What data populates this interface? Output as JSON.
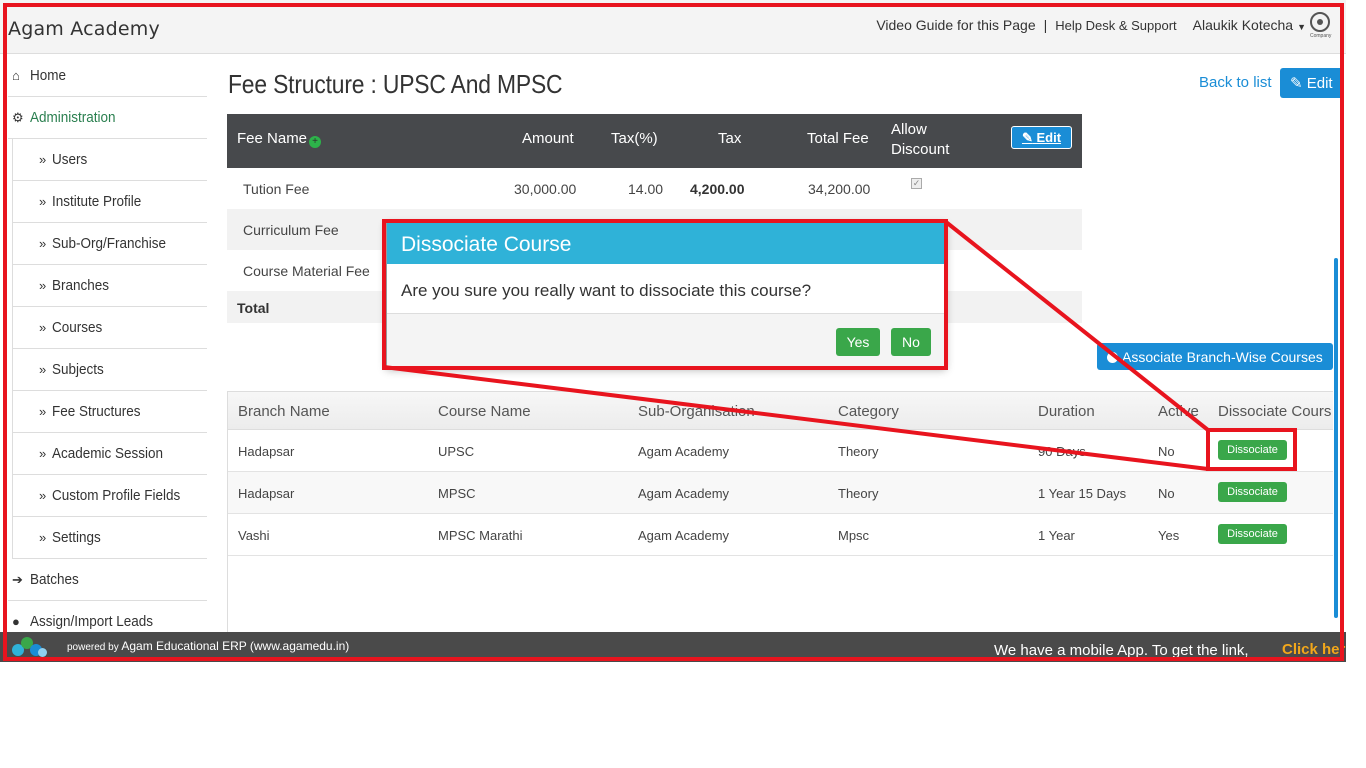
{
  "header": {
    "brand": "Agam Academy",
    "video_guide": "Video Guide for this Page",
    "separator": "|",
    "help": "Help Desk & Support",
    "user": "Alaukik Kotecha",
    "company_caption": "Company"
  },
  "sidebar": {
    "items": [
      {
        "label": "Home",
        "icon": "home-icon"
      },
      {
        "label": "Administration",
        "icon": "gear-icon"
      },
      {
        "label": "Users"
      },
      {
        "label": "Institute Profile"
      },
      {
        "label": "Sub-Org/Franchise"
      },
      {
        "label": "Branches"
      },
      {
        "label": "Courses"
      },
      {
        "label": "Subjects"
      },
      {
        "label": "Fee Structures"
      },
      {
        "label": "Academic Session"
      },
      {
        "label": "Custom Profile Fields"
      },
      {
        "label": "Settings"
      },
      {
        "label": "Batches",
        "icon": "sign-in-icon"
      },
      {
        "label": "Assign/Import Leads",
        "icon": "user-icon"
      }
    ],
    "sub_chevron": "»"
  },
  "main": {
    "title": "Fee Structure : UPSC And MPSC",
    "back_link": "Back to list",
    "edit_label": "Edit"
  },
  "fee_table": {
    "headers": {
      "fee_name": "Fee Name",
      "amount": "Amount",
      "tax_pct": "Tax(%)",
      "tax": "Tax",
      "total_fee": "Total Fee",
      "allow_discount_1": "Allow",
      "allow_discount_2": "Discount",
      "edit": "Edit"
    },
    "rows": [
      {
        "name": "Tution Fee",
        "amount": "30,000.00",
        "tax_pct": "14.00",
        "tax": "4,200.00",
        "total": "34,200.00",
        "allow_discount": true
      },
      {
        "name": "Curriculum Fee"
      },
      {
        "name": "Course Material Fee"
      }
    ],
    "total_label": "Total"
  },
  "associate_button": "Associate Branch-Wise Courses",
  "branch_table": {
    "headers": {
      "branch": "Branch Name",
      "course": "Course Name",
      "suborg": "Sub-Organisation",
      "category": "Category",
      "duration": "Duration",
      "active": "Active",
      "dissociate": "Dissociate Cours"
    },
    "rows": [
      {
        "branch": "Hadapsar",
        "course": "UPSC",
        "suborg": "Agam Academy",
        "category": "Theory",
        "duration": "90 Days",
        "active": "No",
        "action": "Dissociate"
      },
      {
        "branch": "Hadapsar",
        "course": "MPSC",
        "suborg": "Agam Academy",
        "category": "Theory",
        "duration": "1 Year 15 Days",
        "active": "No",
        "action": "Dissociate"
      },
      {
        "branch": "Vashi",
        "course": "MPSC Marathi",
        "suborg": "Agam Academy",
        "category": "Mpsc",
        "duration": "1 Year",
        "active": "Yes",
        "action": "Dissociate"
      }
    ]
  },
  "modal": {
    "title": "Dissociate Course",
    "message": "Are you sure you really want to dissociate this course?",
    "yes": "Yes",
    "no": "No"
  },
  "footer": {
    "powered_prefix": "powered by",
    "powered_text": "Agam Educational ERP (www.agamedu.in)",
    "mobile_text": "We have a mobile App. To get the link,",
    "click_here": "Click her"
  },
  "colors": {
    "accent_blue": "#1a8dd6",
    "modal_header": "#2fb2d8",
    "green_button": "#3aa74a",
    "annotation_red": "#e8141e",
    "table_header": "#47494c"
  }
}
